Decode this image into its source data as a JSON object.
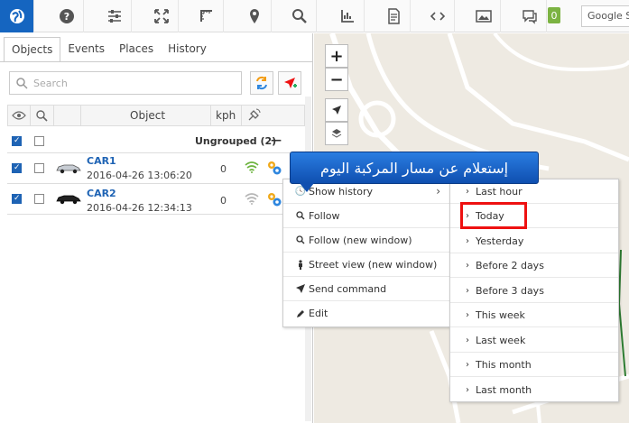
{
  "toolbar": {
    "icons": [
      "globe-icon",
      "help-icon",
      "sliders-icon",
      "fullscreen-icon",
      "ruler-icon",
      "location-pin-icon",
      "search-icon",
      "chart-axis-icon",
      "report-icon",
      "code-icon",
      "image-icon",
      "chat-icon"
    ],
    "unread_count": "0",
    "search_text": "Google St"
  },
  "tabs": [
    "Objects",
    "Events",
    "Places",
    "History"
  ],
  "search": {
    "placeholder": "Search"
  },
  "table": {
    "headers": {
      "object": "Object",
      "speed": "kph"
    },
    "group": {
      "label": "Ungrouped (2)",
      "collapse": "—"
    },
    "rows": [
      {
        "name": "CAR1",
        "time": "2016-04-26 13:06:20",
        "speed": "0",
        "signal_color": "#6cb33e"
      },
      {
        "name": "CAR2",
        "time": "2016-04-26 12:34:13",
        "speed": "0",
        "signal_color": "#b5b5b5"
      }
    ]
  },
  "map": {
    "zoom_in": "+",
    "zoom_out": "−"
  },
  "context_menu": {
    "items": [
      {
        "label": "Show history",
        "icon": "clock-icon",
        "has_submenu": true
      },
      {
        "label": "Follow",
        "icon": "search-icon"
      },
      {
        "label": "Follow (new window)",
        "icon": "search-icon"
      },
      {
        "label": "Street view (new window)",
        "icon": "street-view-icon"
      },
      {
        "label": "Send command",
        "icon": "send-icon"
      },
      {
        "label": "Edit",
        "icon": "pencil-icon"
      }
    ]
  },
  "history_submenu": {
    "items": [
      "Last hour",
      "Today",
      "Yesterday",
      "Before 2 days",
      "Before 3 days",
      "This week",
      "Last week",
      "This month",
      "Last month"
    ]
  },
  "callout": {
    "text": "إستعلام عن مسار المركبة اليوم"
  },
  "colors": {
    "accent": "#1565c0",
    "link": "#1e63b4",
    "highlight": "#ee1111",
    "callout": "#1a66cc"
  }
}
